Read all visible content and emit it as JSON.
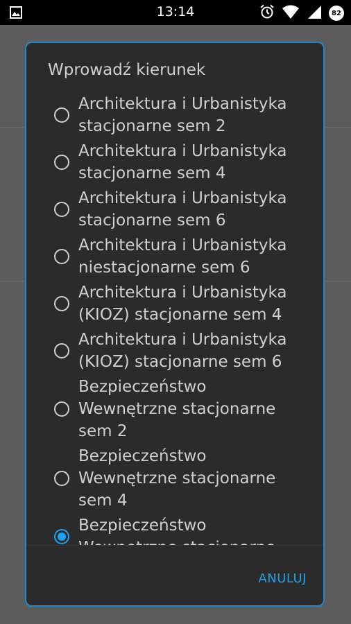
{
  "status_bar": {
    "time": "13:14",
    "battery": "82",
    "icons": [
      "image-icon",
      "alarm-icon",
      "wifi-icon",
      "signal-icon",
      "battery-icon"
    ]
  },
  "dialog": {
    "title": "Wprowadź kierunek",
    "options": [
      {
        "label": "Architektura i Urbanistyka\nstacjonarne sem 2",
        "checked": false
      },
      {
        "label": "Architektura i Urbanistyka\nstacjonarne sem 4",
        "checked": false
      },
      {
        "label": "Architektura i Urbanistyka\nstacjonarne sem 6",
        "checked": false
      },
      {
        "label": "Architektura i Urbanistyka\nniestacjonarne sem 6",
        "checked": false
      },
      {
        "label": "Architektura i Urbanistyka\n(KIOZ) stacjonarne sem 4",
        "checked": false
      },
      {
        "label": "Architektura i Urbanistyka\n(KIOZ) stacjonarne sem 6",
        "checked": false
      },
      {
        "label": "Bezpieczeństwo\nWewnętrzne stacjonarne\nsem 2",
        "checked": false
      },
      {
        "label": "Bezpieczeństwo\nWewnętrzne stacjonarne\nsem 4",
        "checked": false
      },
      {
        "label": "Bezpieczeństwo\nWewnętrzne stacjonarne",
        "checked": true
      }
    ],
    "cancel_label": "ANULUJ"
  },
  "colors": {
    "accent": "#1ea0f0",
    "dialog_bg": "#2b2b2b",
    "text": "#cfcfcf",
    "scrim": "#5c5c5c"
  }
}
